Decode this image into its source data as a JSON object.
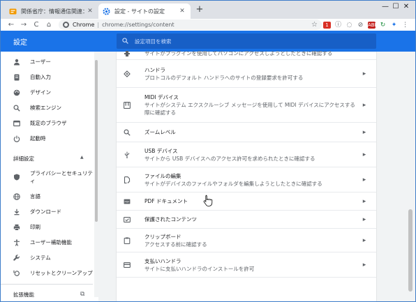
{
  "tabs": [
    {
      "title": "関係省庁：情報通信関連：情報…",
      "close": "✕"
    },
    {
      "title": "設定 - サイトの設定",
      "close": "✕"
    }
  ],
  "newtab": "+",
  "window_controls": {
    "minimize": "—",
    "maximize": "☐",
    "close": "✕"
  },
  "toolbar": {
    "back": "←",
    "forward": "→",
    "reload": "C",
    "home": "⌂"
  },
  "omnibox": {
    "site_label": "Chrome",
    "separator": "|",
    "url": "chrome://settings/content",
    "star": "☆"
  },
  "extensions": [
    {
      "label": "1",
      "color": "#d93025"
    },
    {
      "label": "ⓘ",
      "color": "#5f6368"
    },
    {
      "label": "◌",
      "color": "#5f6368"
    },
    {
      "label": "⊘",
      "color": "#5f6368"
    },
    {
      "label": "ABP",
      "color": "#c5221f"
    },
    {
      "label": "↻",
      "color": "#1e8e3e"
    },
    {
      "label": "✦",
      "color": "#1a73e8"
    },
    {
      "label": "⋮",
      "color": "#5f6368"
    }
  ],
  "header": {
    "title": "設定",
    "search_placeholder": "設定項目を検索"
  },
  "sidebar": {
    "items": [
      {
        "icon": "person-icon",
        "label": "ユーザー"
      },
      {
        "icon": "autofill-icon",
        "label": "自動入力"
      },
      {
        "icon": "palette-icon",
        "label": "デザイン"
      },
      {
        "icon": "search-icon",
        "label": "検索エンジン"
      },
      {
        "icon": "browser-icon",
        "label": "既定のブラウザ"
      },
      {
        "icon": "power-icon",
        "label": "起動時"
      }
    ],
    "advanced_label": "詳細設定",
    "advanced_caret": "▲",
    "advanced_items": [
      {
        "icon": "shield-icon",
        "label": "プライバシーとセキュリティ"
      },
      {
        "icon": "globe-icon",
        "label": "言語"
      },
      {
        "icon": "download-icon",
        "label": "ダウンロード"
      },
      {
        "icon": "print-icon",
        "label": "印刷"
      },
      {
        "icon": "accessibility-icon",
        "label": "ユーザー補助機能"
      },
      {
        "icon": "wrench-icon",
        "label": "システム"
      },
      {
        "icon": "reset-icon",
        "label": "リセットとクリーンアップ"
      }
    ],
    "extensions_label": "拡張機能",
    "extensions_icon": "⧉"
  },
  "main": {
    "rows": [
      {
        "icon": "plugin-icon",
        "title": "",
        "sub": "サイトがプラグインを使用してパソコンにアクセスしようとしたときに確認する"
      },
      {
        "icon": "handler-icon",
        "title": "ハンドラ",
        "sub": "プロトコルのデフォルト ハンドラへのサイトの登録要求を許可する"
      },
      {
        "icon": "midi-icon",
        "title": "MIDI デバイス",
        "sub": "サイトがシステム エクスクルーシブ メッセージを使用して MIDI デバイスにアクセスする際に確認する"
      },
      {
        "icon": "zoom-icon",
        "title": "ズームレベル",
        "sub": ""
      },
      {
        "icon": "usb-icon",
        "title": "USB デバイス",
        "sub": "サイトから USB デバイスへのアクセス許可を求められたときに確認する"
      },
      {
        "icon": "file-edit-icon",
        "title": "ファイルの編集",
        "sub": "サイトがデバイスのファイルやフォルダを編集しようとしたときに確認する"
      },
      {
        "icon": "pdf-icon",
        "title": "PDF ドキュメント",
        "sub": ""
      },
      {
        "icon": "protected-content-icon",
        "title": "保護されたコンテンツ",
        "sub": ""
      },
      {
        "icon": "clipboard-icon",
        "title": "クリップボード",
        "sub": "アクセスする前に確認する"
      },
      {
        "icon": "payment-icon",
        "title": "支払いハンドラ",
        "sub": "サイトに支払いハンドラのインストールを許可"
      }
    ],
    "chevron": "▸"
  }
}
